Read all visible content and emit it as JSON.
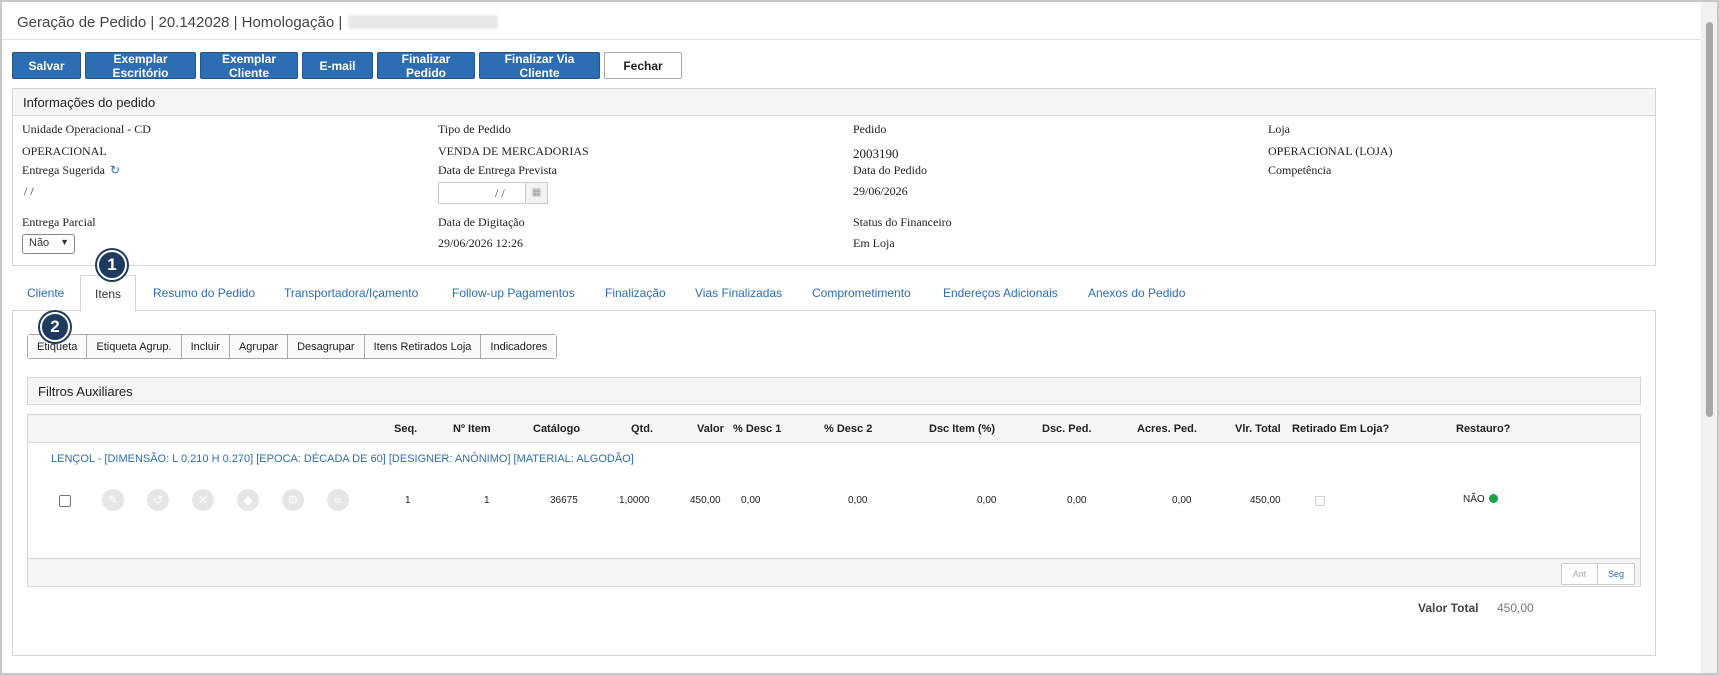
{
  "titlebar": {
    "title": "Geração de Pedido | 20.142028 | Homologação |"
  },
  "toolbar": {
    "buttons": [
      "Salvar",
      "Exemplar Escritório",
      "Exemplar Cliente",
      "E-mail",
      "Finalizar Pedido",
      "Finalizar Via Cliente",
      "Fechar"
    ]
  },
  "info": {
    "header": "Informações do pedido",
    "unidade_label": "Unidade Operacional - CD",
    "unidade_value": "OPERACIONAL",
    "tipo_label": "Tipo de Pedido",
    "tipo_value": "VENDA DE MERCADORIAS",
    "pedido_label": "Pedido",
    "pedido_value": "2003190",
    "loja_label": "Loja",
    "loja_value": "OPERACIONAL (LOJA)",
    "entrega_sugerida_label": "Entrega Sugerida",
    "entrega_sugerida_value": "/ /",
    "data_entrega_label": "Data de Entrega Prevista",
    "data_entrega_value": "/ /",
    "data_pedido_label": "Data do Pedido",
    "data_pedido_value": "29/06/2026",
    "competencia_label": "Competência",
    "entrega_parcial_label": "Entrega Parcial",
    "entrega_parcial_value": "Não",
    "data_digitacao_label": "Data de Digitação",
    "data_digitacao_value": "29/06/2026 12:26",
    "status_fin_label": "Status do Financeiro",
    "status_fin_value": "Em Loja"
  },
  "tabs": [
    "Cliente",
    "Itens",
    "Resumo do Pedido",
    "Transportadora/Içamento",
    "Follow-up Pagamentos",
    "Finalização",
    "Vias Finalizadas",
    "Comprometimento",
    "Endereços Adicionais",
    "Anexos do Pedido"
  ],
  "badges": [
    "1",
    "2"
  ],
  "subtoolbar": [
    "Etiqueta",
    "Etiqueta Agrup.",
    "Incluir",
    "Agrupar",
    "Desagrupar",
    "Itens Retirados Loja",
    "Indicadores"
  ],
  "filters": {
    "title": "Filtros Auxiliares"
  },
  "grid": {
    "headers": [
      "Seq.",
      "Nº Item",
      "Catálogo",
      "Qtd.",
      "Valor",
      "% Desc 1",
      "% Desc 2",
      "Dsc Item (%)",
      "Dsc. Ped.",
      "Acres. Ped.",
      "Vlr. Total",
      "Retirado Em Loja?",
      "Restauro?"
    ],
    "group_title": "LENÇOL - [DIMENSÃO: L 0.210 H 0.270] [EPOCA: DÉCADA DE 60] [DESIGNER: ANÔNIMO] [MATERIAL: ALGODÃO]",
    "row": {
      "seq": "1",
      "item": "1",
      "catalogo": "36675",
      "qtd": "1,0000",
      "valor": "450,00",
      "desc1": "0,00",
      "desc2": "0,00",
      "dsc_item": "0,00",
      "dsc_ped": "0,00",
      "acres_ped": "0,00",
      "vlr_total": "450,00",
      "restauro": "NÃO"
    },
    "row_action_icons": [
      "edit-icon",
      "history-icon",
      "remove-icon",
      "tag-icon",
      "settings-icon",
      "link-icon"
    ]
  },
  "pager": {
    "prev": "Ant",
    "next": "Seg"
  },
  "total": {
    "label": "Valor Total",
    "value": "450,00"
  },
  "colors": {
    "primary": "#2d6db4",
    "badge": "#1f3a5f",
    "status_green": "#1aa34a"
  }
}
